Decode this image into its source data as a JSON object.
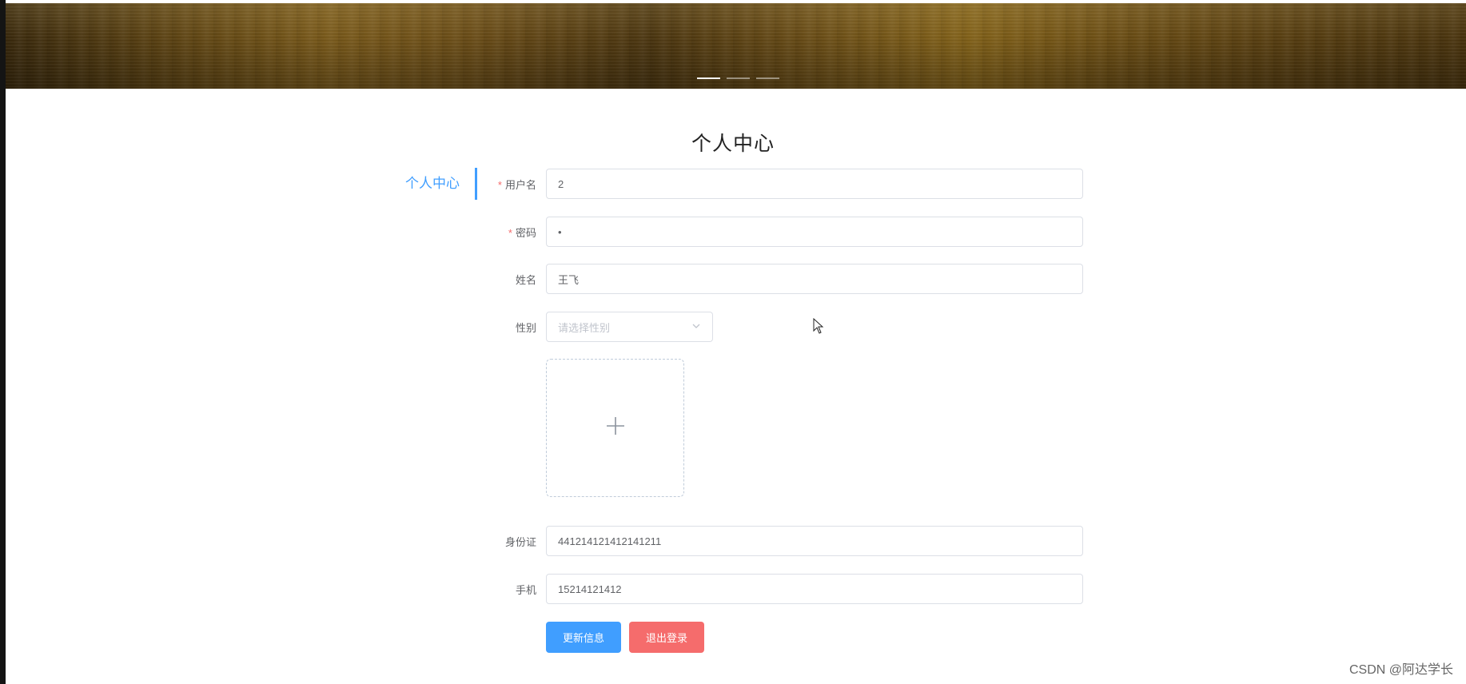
{
  "page": {
    "title": "个人中心"
  },
  "sidebar": {
    "items": [
      {
        "label": "个人中心",
        "active": true
      }
    ]
  },
  "carousel": {
    "slides": 3,
    "active_index": 0
  },
  "form": {
    "username": {
      "label": "用户名",
      "required": true,
      "value": "2"
    },
    "password": {
      "label": "密码",
      "required": true,
      "value": "•"
    },
    "name": {
      "label": "姓名",
      "required": false,
      "value": "王飞"
    },
    "gender": {
      "label": "性别",
      "required": false,
      "value": "",
      "placeholder": "请选择性别"
    },
    "avatar": {
      "upload_icon": "plus-icon"
    },
    "id_card": {
      "label": "身份证",
      "required": false,
      "value": "441214121412141211"
    },
    "phone": {
      "label": "手机",
      "required": false,
      "value": "15214121412"
    }
  },
  "actions": {
    "update_label": "更新信息",
    "logout_label": "退出登录"
  },
  "colors": {
    "primary": "#409eff",
    "danger": "#f56c6c",
    "required": "#f56c6c",
    "border": "#dcdfe6"
  },
  "watermark": "CSDN @阿达学长"
}
